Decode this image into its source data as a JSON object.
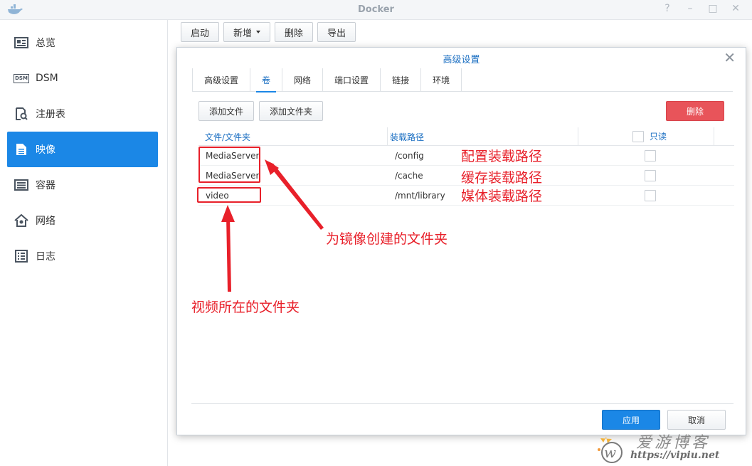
{
  "window": {
    "title": "Docker",
    "controls": [
      "?",
      "–",
      "□",
      "✕"
    ]
  },
  "sidebar": {
    "items": [
      {
        "label": "总览",
        "icon": "overview-icon"
      },
      {
        "label": "DSM",
        "icon": "dsm-icon",
        "badge": "DSM"
      },
      {
        "label": "注册表",
        "icon": "registry-icon"
      },
      {
        "label": "映像",
        "icon": "image-icon",
        "active": true
      },
      {
        "label": "容器",
        "icon": "container-icon"
      },
      {
        "label": "网络",
        "icon": "network-icon"
      },
      {
        "label": "日志",
        "icon": "log-icon"
      }
    ]
  },
  "toolbar": {
    "launch": "启动",
    "add": "新增",
    "delete": "删除",
    "export": "导出"
  },
  "dialog": {
    "title": "高级设置",
    "close": "✕",
    "tabs": [
      "高级设置",
      "卷",
      "网络",
      "端口设置",
      "链接",
      "环境"
    ],
    "active_tab": 1,
    "add_file": "添加文件",
    "add_folder": "添加文件夹",
    "remove": "删除",
    "columns": {
      "file_folder": "文件/文件夹",
      "mount_path": "装载路径",
      "read_only": "只读"
    },
    "rows": [
      {
        "folder": "MediaServer",
        "path": "/config",
        "read_only": false
      },
      {
        "folder": "MediaServer",
        "path": "/cache",
        "read_only": false
      },
      {
        "folder": "video",
        "path": "/mnt/library",
        "read_only": false
      }
    ],
    "apply": "应用",
    "cancel": "取消"
  },
  "annotations": {
    "config": "配置装载路径",
    "cache": "缓存装载路径",
    "media": "媒体装载路径",
    "folder_for_image": "为镜像创建的文件夹",
    "video_folder": "视频所在的文件夹",
    "color": "#e8202a"
  },
  "watermark": {
    "title": "爱游博客",
    "url": "https://vipiu.net"
  },
  "colors": {
    "accent": "#1b87e6",
    "danger": "#e8545a",
    "annotation": "#e8202a"
  }
}
